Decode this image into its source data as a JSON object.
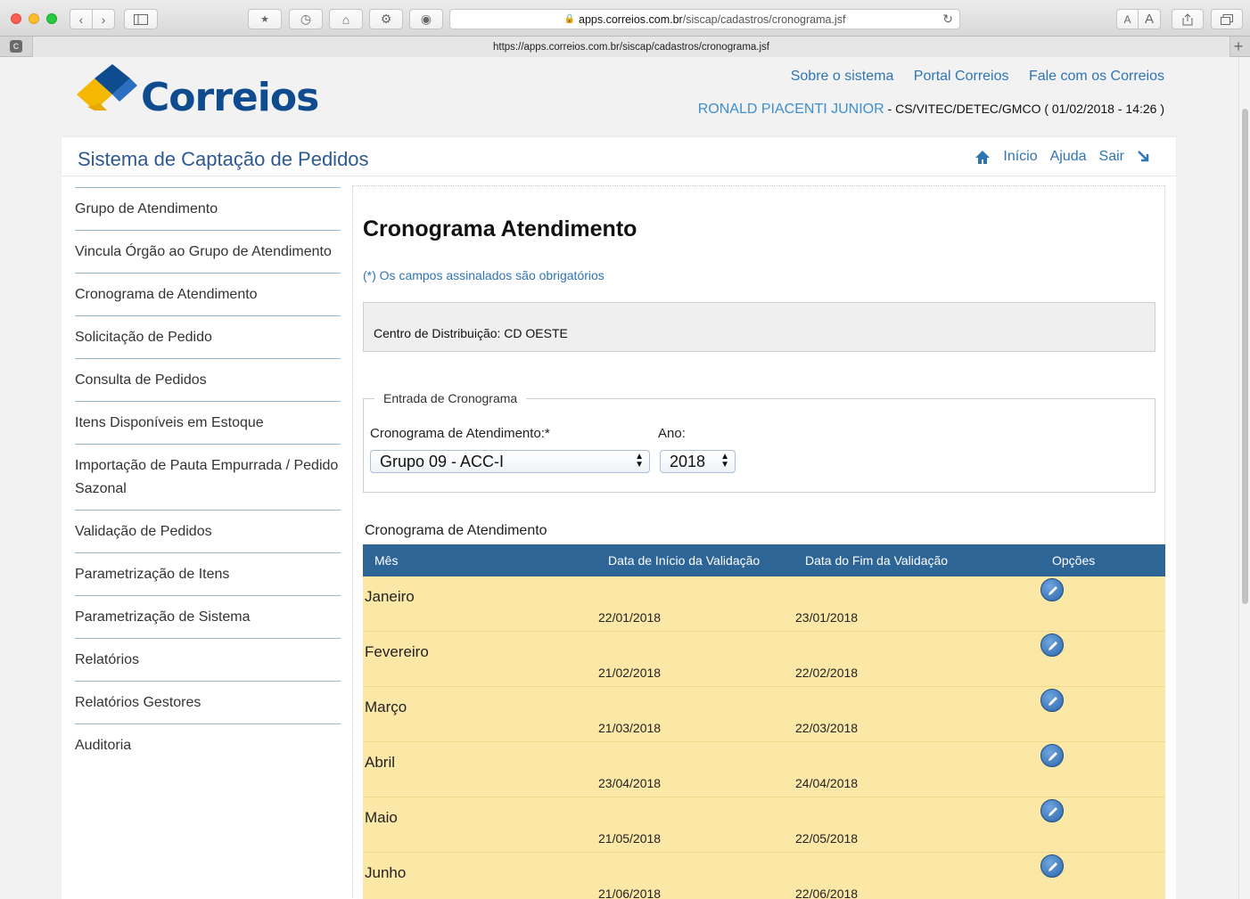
{
  "browser": {
    "url_host": "apps.correios.com.br",
    "url_path": "/siscap/cadastros/cronograma.jsf",
    "tab_title": "https://apps.correios.com.br/siscap/cadastros/cronograma.jsf",
    "favicon_letter": "C",
    "text_size_small": "A",
    "text_size_large": "A"
  },
  "header": {
    "logo_text": "Correios",
    "links": [
      "Sobre o sistema",
      "Portal Correios",
      "Fale com os Correios"
    ],
    "user_name": "RONALD PIACENTI JUNIOR",
    "user_info": " - CS/VITEC/DETEC/GMCO ( 01/02/2018 - 14:26 )"
  },
  "panel": {
    "system_title": "Sistema de Captação de Pedidos",
    "nav_home": "Início",
    "nav_help": "Ajuda",
    "nav_exit": "Sair"
  },
  "sidebar": {
    "items": [
      "Grupo de Atendimento",
      "Vincula Órgão ao Grupo de Atendimento",
      "Cronograma de Atendimento",
      "Solicitação de Pedido",
      "Consulta de Pedidos",
      "Itens Disponíveis em Estoque",
      "Importação de Pauta Empurrada / Pedido Sazonal",
      "Validação de Pedidos",
      "Parametrização de Itens",
      "Parametrização de Sistema",
      "Relatórios",
      "Relatórios Gestores",
      "Auditoria"
    ]
  },
  "main": {
    "title": "Cronograma Atendimento",
    "required_note": "(*) Os campos assinalados são obrigatórios",
    "distribution_center": "Centro de Distribuição: CD OESTE",
    "form": {
      "legend": "Entrada de Cronograma",
      "schedule_label": "Cronograma de Atendimento:*",
      "schedule_value": "Grupo 09 - ACC-I",
      "year_label": "Ano:",
      "year_value": "2018"
    },
    "table": {
      "title": "Cronograma de Atendimento",
      "columns": [
        "Mês",
        "Data de Início da Validação",
        "Data do Fim da Validação",
        "Opções"
      ],
      "rows": [
        {
          "mes": "Janeiro",
          "inicio": "22/01/2018",
          "fim": "23/01/2018"
        },
        {
          "mes": "Fevereiro",
          "inicio": "21/02/2018",
          "fim": "22/02/2018"
        },
        {
          "mes": "Março",
          "inicio": "21/03/2018",
          "fim": "22/03/2018"
        },
        {
          "mes": "Abril",
          "inicio": "23/04/2018",
          "fim": "24/04/2018"
        },
        {
          "mes": "Maio",
          "inicio": "21/05/2018",
          "fim": "22/05/2018"
        },
        {
          "mes": "Junho",
          "inicio": "21/06/2018",
          "fim": "22/06/2018"
        }
      ]
    }
  },
  "colors": {
    "brand_blue": "#0f4b8f",
    "link_blue": "#2f74b5",
    "table_header": "#2d6597",
    "row_yellow": "#fbe7a6"
  }
}
